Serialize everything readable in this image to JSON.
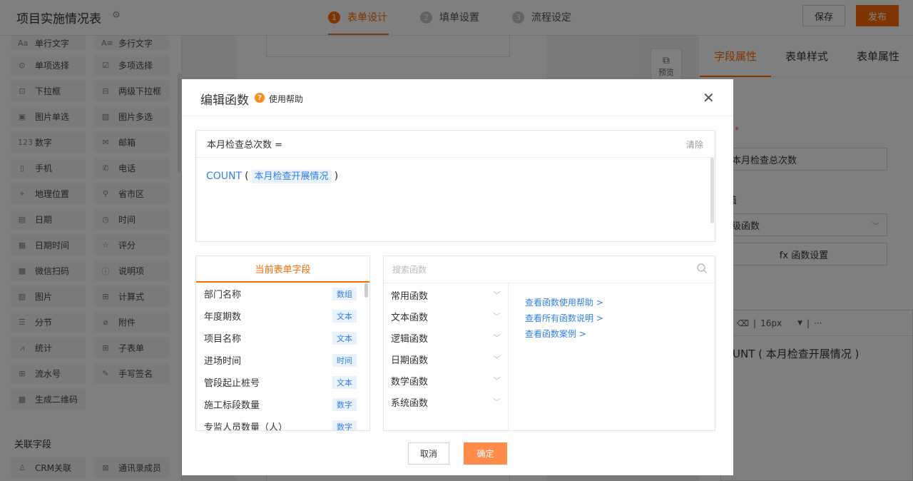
{
  "header": {
    "title": "项目实施情况表",
    "steps": [
      {
        "num": "1",
        "label": "表单设计",
        "active": true
      },
      {
        "num": "2",
        "label": "填单设置",
        "active": false
      },
      {
        "num": "3",
        "label": "流程设定",
        "active": false
      }
    ],
    "save_label": "保存",
    "publish_label": "发布"
  },
  "widgets": [
    {
      "icon": "Aa",
      "label": "单行文字"
    },
    {
      "icon": "A≡",
      "label": "多行文字"
    },
    {
      "icon": "⊙",
      "label": "单项选择"
    },
    {
      "icon": "☑",
      "label": "多项选择"
    },
    {
      "icon": "⊡",
      "label": "下拉框"
    },
    {
      "icon": "⊟",
      "label": "两级下拉框"
    },
    {
      "icon": "▣",
      "label": "图片单选"
    },
    {
      "icon": "▨",
      "label": "图片多选"
    },
    {
      "icon": "123",
      "label": "数字"
    },
    {
      "icon": "✉",
      "label": "邮箱"
    },
    {
      "icon": "▯",
      "label": "手机"
    },
    {
      "icon": "✆",
      "label": "电话"
    },
    {
      "icon": "⌖",
      "label": "地理位置"
    },
    {
      "icon": "⚲",
      "label": "省市区"
    },
    {
      "icon": "▤",
      "label": "日期"
    },
    {
      "icon": "◷",
      "label": "时间"
    },
    {
      "icon": "▦",
      "label": "日期时间"
    },
    {
      "icon": "☆",
      "label": "评分"
    },
    {
      "icon": "▩",
      "label": "微信扫码"
    },
    {
      "icon": "ⓘ",
      "label": "说明项"
    },
    {
      "icon": "▨",
      "label": "图片"
    },
    {
      "icon": "⊞",
      "label": "计算式"
    },
    {
      "icon": "☰",
      "label": "分节"
    },
    {
      "icon": "⌀",
      "label": "附件"
    },
    {
      "icon": "⩘",
      "label": "统计"
    },
    {
      "icon": "⊞",
      "label": "子表单"
    },
    {
      "icon": "⊞",
      "label": "流水号"
    },
    {
      "icon": "✎",
      "label": "手写签名"
    },
    {
      "icon": "▩",
      "label": "生成二维码"
    }
  ],
  "related": {
    "title": "关联字段",
    "items": [
      {
        "icon": "♙",
        "label": "CRM关联"
      },
      {
        "icon": "⊠",
        "label": "通讯录成员"
      }
    ]
  },
  "preview": {
    "label": "预览"
  },
  "right_panel": {
    "tabs": [
      "字段属性",
      "表单样式",
      "表单属性"
    ],
    "active_tab": 0,
    "field_name": "本月检查总次数",
    "default_label": "值",
    "default_value": "级函数",
    "fx_button": "fx 函数设置",
    "font_size": "16px",
    "editor_content": "UNT ( 本月检查开展情况 )"
  },
  "modal": {
    "title": "编辑函数",
    "help_link": "使用帮助",
    "formula_label": "本月检查总次数 =",
    "clear_label": "清除",
    "formula": {
      "fn": "COUNT",
      "field": "本月检查开展情况"
    },
    "fields_tab": "当前表单字段",
    "fields": [
      {
        "name": "部门名称",
        "type": "数组"
      },
      {
        "name": "年度期数",
        "type": "文本"
      },
      {
        "name": "项目名称",
        "type": "文本"
      },
      {
        "name": "进场时间",
        "type": "时间"
      },
      {
        "name": "管段起止桩号",
        "type": "文本"
      },
      {
        "name": "施工标段数量",
        "type": "数字"
      },
      {
        "name": "专监人员数量（人）",
        "type": "数字"
      }
    ],
    "search_placeholder": "搜索函数",
    "categories": [
      "常用函数",
      "文本函数",
      "逻辑函数",
      "日期函数",
      "数学函数",
      "系统函数"
    ],
    "help_links": [
      "查看函数使用帮助 >",
      "查看所有函数说明 >",
      "查看函数案例 >"
    ],
    "cancel_label": "取消",
    "ok_label": "确定"
  },
  "colors": {
    "accent": "#ff6a00",
    "link": "#2f80ed"
  }
}
